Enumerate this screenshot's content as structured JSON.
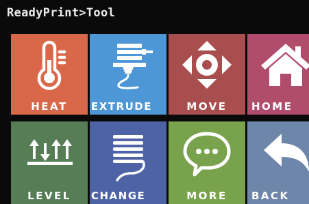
{
  "header": {
    "title": "ReadyPrint>Tool"
  },
  "tiles": [
    {
      "label": "HEAT",
      "icon": "thermometer-icon",
      "color": "#d9684a"
    },
    {
      "label": "EXTRUDE",
      "icon": "extruder-icon",
      "color": "#4d97d6"
    },
    {
      "label": "MOVE",
      "icon": "move-arrows-icon",
      "color": "#a84e4e"
    },
    {
      "label": "HOME",
      "icon": "house-icon",
      "color": "#b04c6c"
    },
    {
      "label": "LEVEL",
      "icon": "level-arrows-icon",
      "color": "#567d56"
    },
    {
      "label": "CHANGE",
      "icon": "filament-spool-icon",
      "color": "#4e62a6"
    },
    {
      "label": "MORE",
      "icon": "chat-bubble-icon",
      "color": "#79a24c"
    },
    {
      "label": "BACK",
      "icon": "back-arrow-icon",
      "color": "#6e86aa"
    }
  ]
}
